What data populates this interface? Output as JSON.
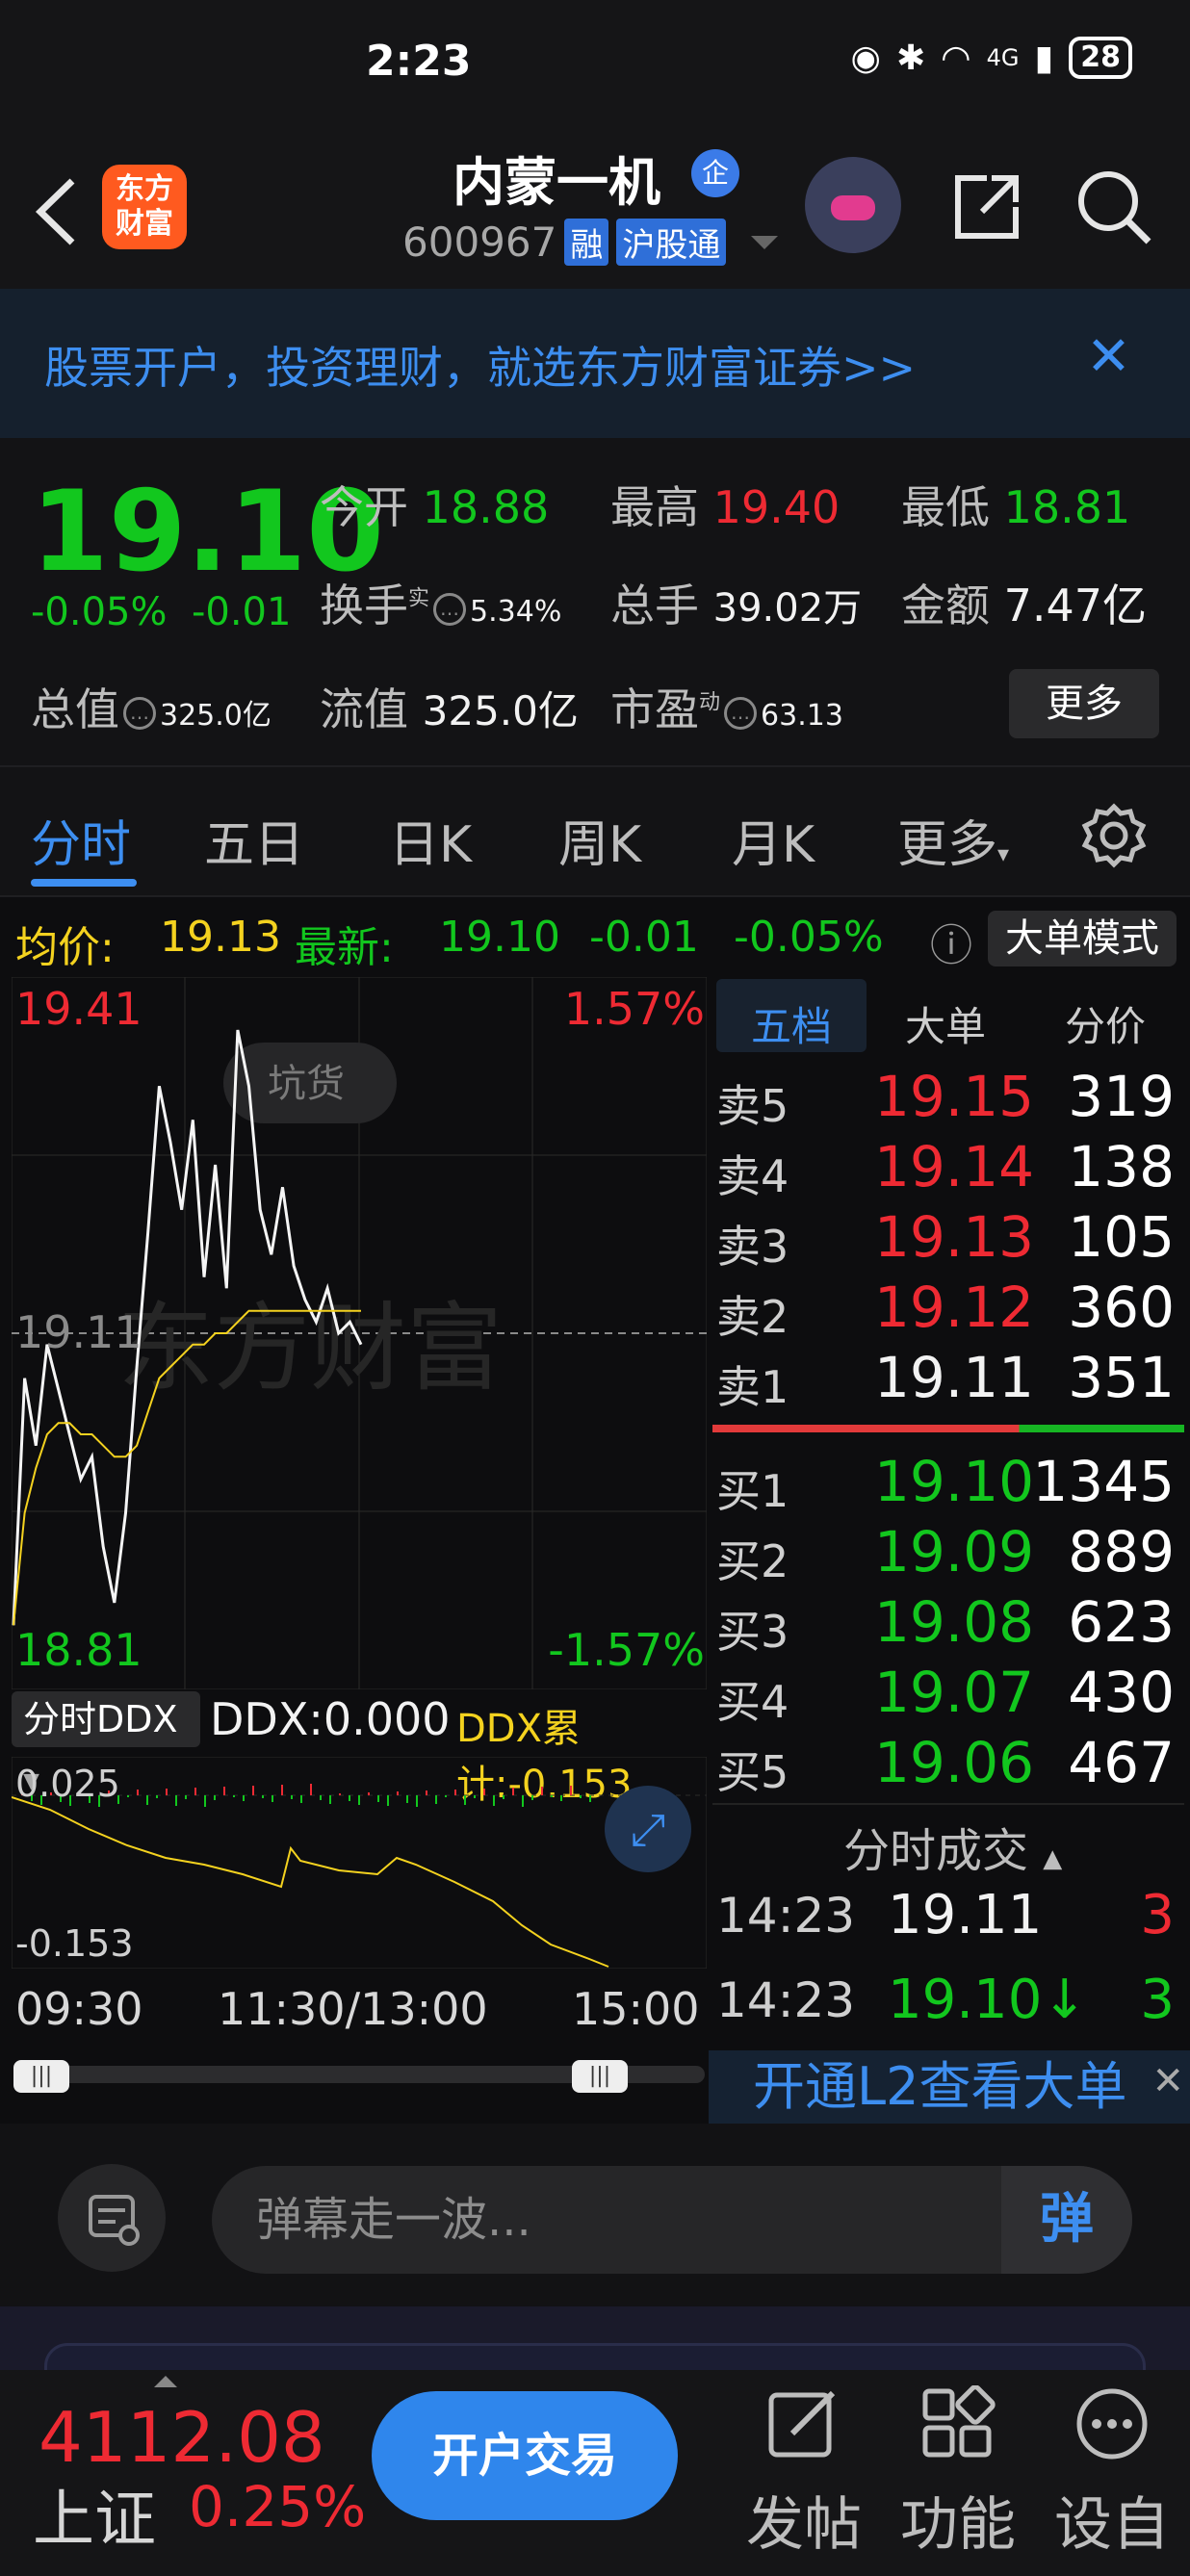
{
  "status_bar": {
    "time": "2:23",
    "network": "4G",
    "battery": "28"
  },
  "header": {
    "logo_line1": "东方",
    "logo_line2": "财富",
    "title": "内蒙一机",
    "badge": "企",
    "code": "600967",
    "tag1": "融",
    "tag2": "沪股通"
  },
  "banner": {
    "text": "股票开户，投资理财，就选东方财富证券>>",
    "close": "✕"
  },
  "quote": {
    "price": "19.10",
    "change_pct": "-0.05%",
    "change": "-0.01",
    "open_label": "今开",
    "open": "18.88",
    "high_label": "最高",
    "high": "19.40",
    "low_label": "最低",
    "low": "18.81",
    "turnover_label": "换手",
    "turnover_sup": "实",
    "turnover": "5.34%",
    "volume_label": "总手",
    "volume": "39.02万",
    "amount_label": "金额",
    "amount": "7.47亿",
    "mktcap_label": "总值",
    "mktcap": "325.0亿",
    "float_label": "流值",
    "float": "325.0亿",
    "pe_label": "市盈",
    "pe_sup": "动",
    "pe": "63.13",
    "more": "更多"
  },
  "tabs": [
    "分时",
    "五日",
    "日K",
    "周K",
    "月K",
    "更多"
  ],
  "avg_row": {
    "avg_label": "均价:",
    "avg": "19.13",
    "latest_label": "最新:",
    "latest": "19.10",
    "chg": "-0.01",
    "chg_pct": "-0.05%",
    "mode_button": "大单模式"
  },
  "chart": {
    "y_high": "19.41",
    "y_low": "18.81",
    "y_mid": "19.11",
    "pct_high": "1.57%",
    "pct_low": "-1.57%",
    "bubble": "坑货",
    "watermark": "东方财富",
    "time_labels": [
      "09:30",
      "11:30/13:00",
      "15:00"
    ]
  },
  "ddx": {
    "selector": "分时DDX",
    "value_label": "DDX:0.000",
    "cum_label": "DDX累计:-0.153",
    "y_top": "0.025",
    "y_bottom": "-0.153"
  },
  "book": {
    "tabs": [
      "五档",
      "大单",
      "分价"
    ],
    "asks": [
      {
        "label": "卖5",
        "price": "19.15",
        "vol": "319"
      },
      {
        "label": "卖4",
        "price": "19.14",
        "vol": "138"
      },
      {
        "label": "卖3",
        "price": "19.13",
        "vol": "105"
      },
      {
        "label": "卖2",
        "price": "19.12",
        "vol": "360"
      },
      {
        "label": "卖1",
        "price": "19.11",
        "vol": "351"
      }
    ],
    "bids": [
      {
        "label": "买1",
        "price": "19.10",
        "vol": "1345"
      },
      {
        "label": "买2",
        "price": "19.09",
        "vol": "889"
      },
      {
        "label": "买3",
        "price": "19.08",
        "vol": "623"
      },
      {
        "label": "买4",
        "price": "19.07",
        "vol": "430"
      },
      {
        "label": "买5",
        "price": "19.06",
        "vol": "467"
      }
    ],
    "trades_title": "分时成交",
    "trades": [
      {
        "time": "14:23",
        "price": "19.11",
        "vol": "3"
      },
      {
        "time": "14:23",
        "price": "19.10↓",
        "vol": "3"
      }
    ],
    "l2": "开通L2查看大单"
  },
  "danmu": {
    "placeholder": "弹幕走一波...",
    "button": "弹"
  },
  "bottom": {
    "index_value": "4112.08",
    "index_name": "上证",
    "index_pct": "0.25%",
    "trade_button": "开户交易",
    "items": [
      "发帖",
      "功能",
      "设自"
    ]
  },
  "colors": {
    "up": "#ee2a33",
    "down": "#12c71e",
    "accent": "#3d8ef0",
    "avg_line": "#f4d21f"
  },
  "chart_data": {
    "type": "line",
    "ylim": [
      18.81,
      19.41
    ],
    "series": [
      {
        "values": [
          18.85,
          19.07,
          19.01,
          19.1,
          19.06,
          19.02,
          18.98,
          19.0,
          18.92,
          18.87,
          18.95,
          19.08,
          19.2,
          19.33,
          19.28,
          19.22,
          19.3,
          19.16,
          19.26,
          19.15,
          19.38,
          19.33,
          19.22,
          19.18,
          19.24,
          19.17,
          19.14,
          19.12,
          19.15,
          19.11,
          19.12,
          19.1
        ]
      },
      {
        "values": [
          18.85,
          18.95,
          18.99,
          19.02,
          19.03,
          19.03,
          19.02,
          19.02,
          19.01,
          19.0,
          19.0,
          19.01,
          19.04,
          19.07,
          19.08,
          19.09,
          19.1,
          19.1,
          19.11,
          19.11,
          19.12,
          19.13,
          19.13,
          19.13,
          19.13,
          19.13,
          19.13,
          19.13,
          19.13,
          19.13,
          19.13,
          19.13
        ]
      }
    ]
  }
}
